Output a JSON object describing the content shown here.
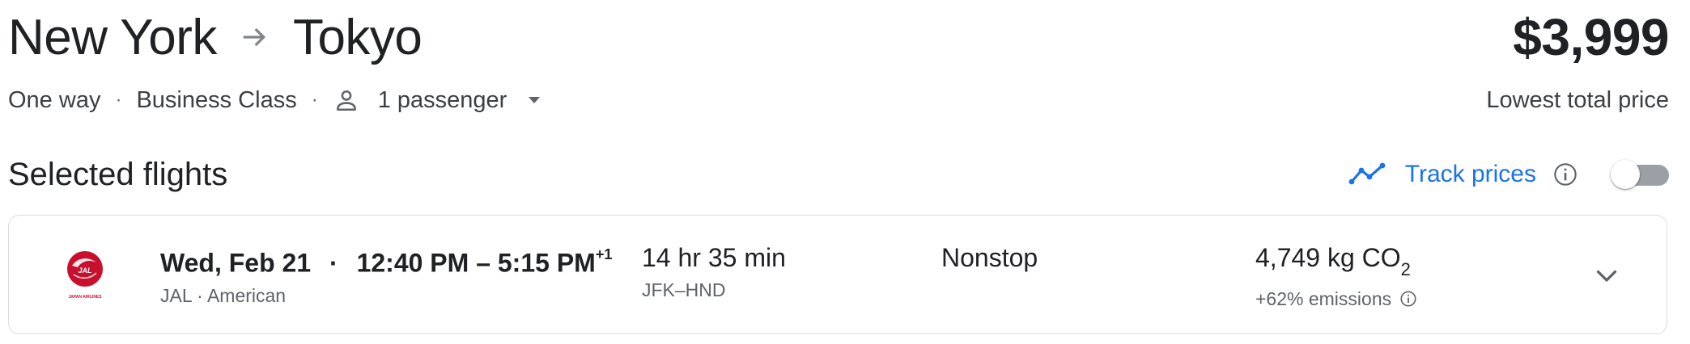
{
  "header": {
    "origin": "New York",
    "destination": "Tokyo",
    "price": "$3,999",
    "price_label": "Lowest total price"
  },
  "trip": {
    "type": "One way",
    "separator": "·",
    "cabin": "Business Class",
    "passengers": "1 passenger"
  },
  "section": {
    "title": "Selected flights",
    "track_label": "Track prices",
    "track_enabled": false
  },
  "flight": {
    "date": "Wed, Feb 21",
    "dot": "·",
    "times": "12:40 PM – 5:15 PM",
    "day_offset": "+1",
    "airlines": "JAL · American",
    "duration": "14 hr 35 min",
    "route": "JFK–HND",
    "stops": "Nonstop",
    "co2_value": "4,749 kg CO",
    "co2_subscript": "2",
    "emissions": "+62% emissions",
    "logo_text": "JAPAN AIRLINES"
  },
  "colors": {
    "accent": "#1a73e8",
    "text_primary": "#202124",
    "text_secondary": "#5f6368",
    "border": "#dadce0",
    "jal_red": "#c8102e"
  }
}
